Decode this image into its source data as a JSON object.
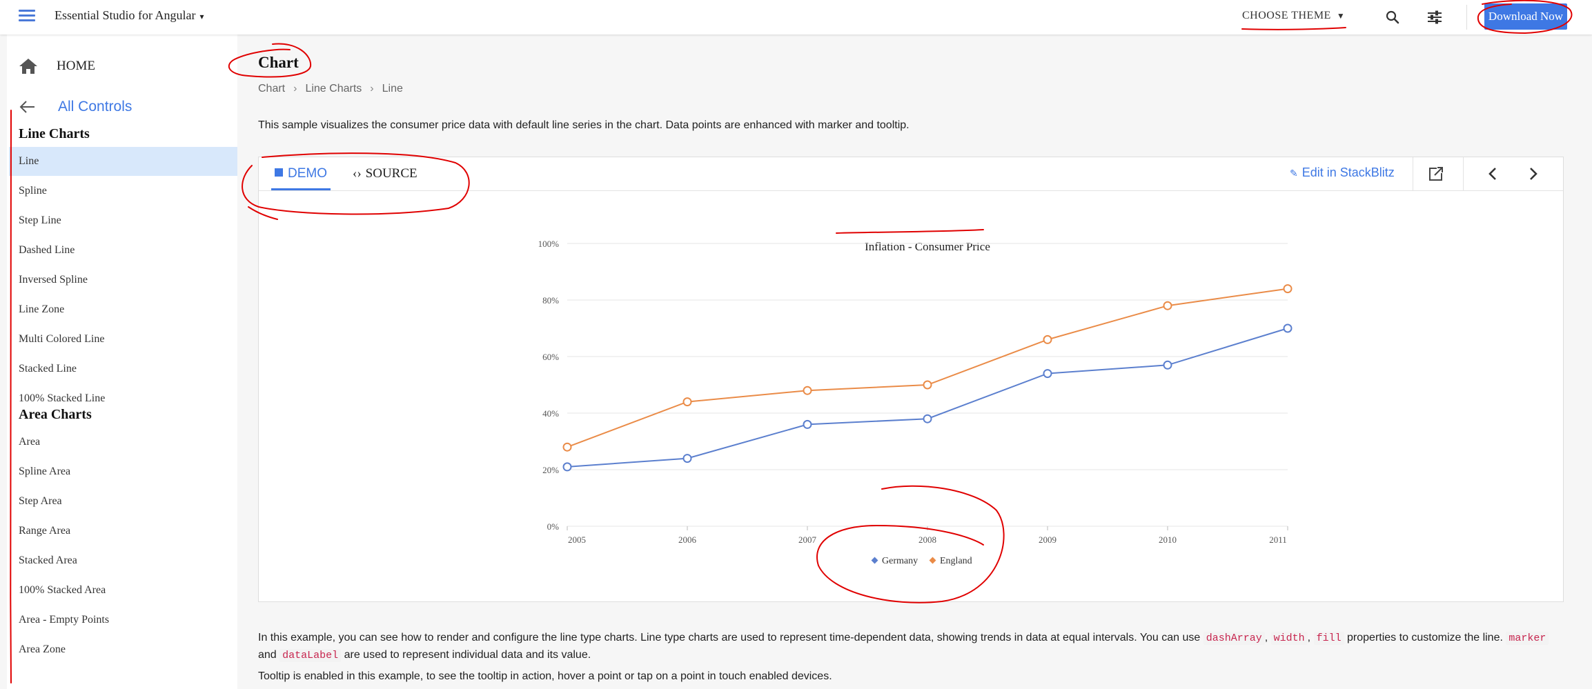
{
  "topbar": {
    "product": "Essential Studio for Angular",
    "theme_label": "CHOOSE THEME",
    "download_label": "Download Now"
  },
  "sidebar": {
    "home_label": "HOME",
    "back_label": "All Controls",
    "sections": [
      {
        "title": "Line Charts",
        "items": [
          "Line",
          "Spline",
          "Step Line",
          "Dashed Line",
          "Inversed Spline",
          "Line Zone",
          "Multi Colored Line",
          "Stacked Line",
          "100% Stacked Line"
        ]
      },
      {
        "title": "Area Charts",
        "items": [
          "Area",
          "Spline Area",
          "Step Area",
          "Range Area",
          "Stacked Area",
          "100% Stacked Area",
          "Area - Empty Points",
          "Area Zone"
        ]
      }
    ],
    "active_item": "Line"
  },
  "main": {
    "title": "Chart",
    "breadcrumb": [
      "Chart",
      "Line Charts",
      "Line"
    ],
    "description": "This sample visualizes the consumer price data with default line series in the chart. Data points are enhanced with marker and tooltip.",
    "tabs": {
      "demo": "DEMO",
      "source": "SOURCE"
    },
    "edit_label": "Edit in StackBlitz",
    "footer": {
      "p1_a": "In this example, you can see how to render and configure the line type charts. Line type charts are used to represent time-dependent data, showing trends in data at equal intervals. You can use ",
      "code1": "dashArray",
      "sep1": ", ",
      "code2": "width",
      "sep2": ", ",
      "code3": "fill",
      "p1_b": " properties to customize the line. ",
      "code4": "marker",
      "and": " and ",
      "code5": "dataLabel",
      "p1_c": " are used to represent individual data and its value.",
      "p2": "Tooltip is enabled in this example, to see the tooltip in action, hover a point or tap on a point in touch enabled devices."
    }
  },
  "chart_data": {
    "type": "line",
    "title": "Inflation - Consumer Price",
    "x": [
      2005,
      2006,
      2007,
      2008,
      2009,
      2010,
      2011
    ],
    "series": [
      {
        "name": "Germany",
        "values": [
          21,
          24,
          36,
          38,
          54,
          57,
          70
        ],
        "color": "#5b7fce"
      },
      {
        "name": "England",
        "values": [
          28,
          44,
          48,
          50,
          66,
          78,
          84
        ],
        "color": "#ea8b47"
      }
    ],
    "ylim": [
      0,
      100
    ],
    "yticks": [
      0,
      20,
      40,
      60,
      80,
      100
    ],
    "y_format": "percent",
    "grid": true,
    "legend": "bottom"
  },
  "colors": {
    "accent": "#3e78e4",
    "annotation": "#e00000"
  }
}
